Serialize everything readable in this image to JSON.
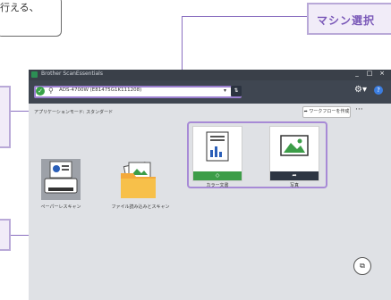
{
  "callouts": {
    "top_text_line1": "行える、",
    "machine_select": "マシン選択"
  },
  "window": {
    "title": "Brother ScanEssentials",
    "controls": [
      "_",
      "□",
      "×"
    ]
  },
  "toolbar": {
    "device_name": "ADS-4700W (E81475G1K111208)",
    "dropdown_caret": "▾",
    "settings_icon": "⇅",
    "gear_icon": "⚙▾",
    "help_icon": "?"
  },
  "content": {
    "mode_label": "アプリケーションモード: スタンダード",
    "workflow_button": "ワークフローを作成",
    "more_button": "···",
    "tiles": [
      {
        "label": "ペーパーレスキャン"
      },
      {
        "label": "ファイル読み込みとスキャン"
      }
    ],
    "scan_cards": [
      {
        "label": "カラー文書",
        "bar_icon": "◇",
        "bar_color": "#3c9d48"
      },
      {
        "label": "写真",
        "bar_icon": "➦",
        "bar_color": "#2e3643"
      }
    ]
  },
  "colors": {
    "callout_border": "#b9a9d8",
    "callout_fill": "#f1ecf8",
    "accent_purple": "#7a58b8",
    "titlebar": "#3a4049",
    "content_bg": "#dfe1e5"
  }
}
